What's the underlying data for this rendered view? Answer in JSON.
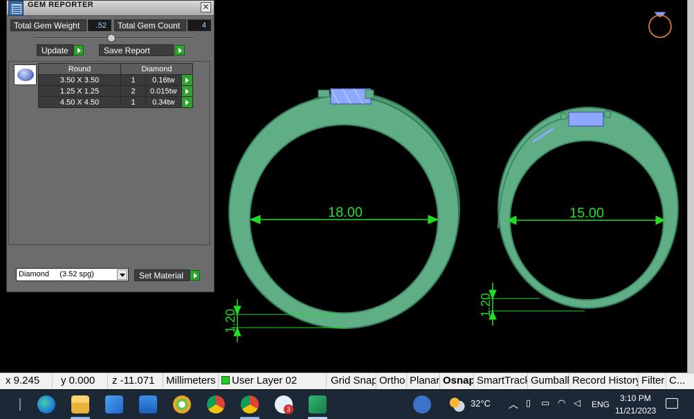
{
  "gem_reporter": {
    "title": "GEM REPORTER",
    "close_label": "✕",
    "total_weight_label": "Total Gem Weight",
    "total_weight_value": ".52",
    "total_count_label": "Total Gem Count",
    "total_count_value": "4",
    "update_label": "Update",
    "save_report_label": "Save Report",
    "table": {
      "shape_header": "Round",
      "material_header": "Diamond",
      "rows": [
        {
          "size": "3.50 X 3.50",
          "qty": "1",
          "weight": "0.16tw"
        },
        {
          "size": "1.25 X 1.25",
          "qty": "2",
          "weight": "0.015tw"
        },
        {
          "size": "4.50 X 4.50",
          "qty": "1",
          "weight": "0.34tw"
        }
      ]
    },
    "material_select_value": "Diamond     (3.52 spg)",
    "set_material_label": "Set Material"
  },
  "viewport": {
    "dimensions": {
      "left_ring_diameter": "18.00",
      "right_ring_diameter": "15.00",
      "left_thickness": "1.20",
      "right_thickness": "1.20"
    },
    "colors": {
      "ring_fill": "#5fae86",
      "ring_edge": "#2f7a55",
      "dimension": "#22dd22",
      "gem": "#8fa8ff",
      "ring_icon": "#ff8833"
    }
  },
  "statusbar": {
    "x": "x 9.245",
    "y": "y 0.000",
    "z": "z -11.071",
    "units": "Millimeters",
    "layer": "User Layer 02",
    "grid_snap": "Grid Snap",
    "ortho": "Ortho",
    "planar": "Planar",
    "osnap": "Osnap",
    "smarttrack": "SmartTrack",
    "gumball": "Gumball",
    "record_history": "Record History",
    "filter": "Filter",
    "more": "C..."
  },
  "taskbar": {
    "weather_temp": "32°C",
    "language": "ENG",
    "time": "3:10 PM",
    "date": "11/21/2023",
    "zoom_badge": "3"
  }
}
